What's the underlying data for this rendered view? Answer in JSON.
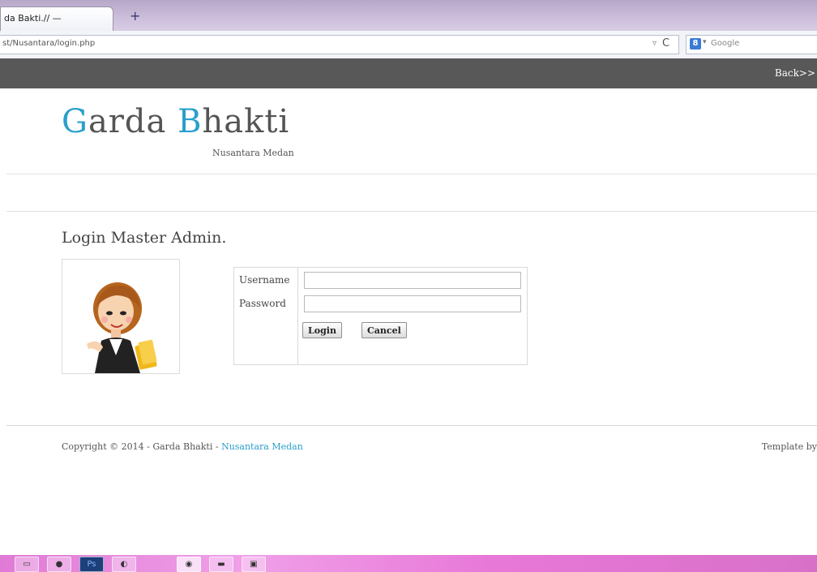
{
  "browser": {
    "tab_title": "da Bakti.// —",
    "new_tab": "+",
    "url": "st/Nusantara/login.php",
    "url_dropdown": "▿",
    "reload": "C",
    "search_engine": "8",
    "search_placeholder": "Google",
    "search_dropdown": "▾"
  },
  "site": {
    "back_link": "Back>>",
    "logo": {
      "g": "G",
      "arda": "arda ",
      "b": "B",
      "hakti": "hakti"
    },
    "tagline": "Nusantara Medan",
    "login_title": "Login Master Admin."
  },
  "form": {
    "username_label": "Username",
    "password_label": "Password",
    "username_value": "",
    "password_value": "",
    "login_button": "Login",
    "cancel_button": "Cancel"
  },
  "footer": {
    "copyright": "Copyright © 2014 - Garda Bhakti - ",
    "link": "Nusantara Medan",
    "template_by": "Template by"
  },
  "taskbar": {
    "icons": [
      "explorer-icon",
      "folder-icon",
      "photoshop-icon",
      "firefox-icon",
      "media-icon",
      "monitor-icon",
      "app-icon"
    ],
    "ps_label": "Ps"
  },
  "colors": {
    "accent": "#2a9fcb",
    "topbar": "#585858",
    "taskbar": "#e07ad6"
  }
}
